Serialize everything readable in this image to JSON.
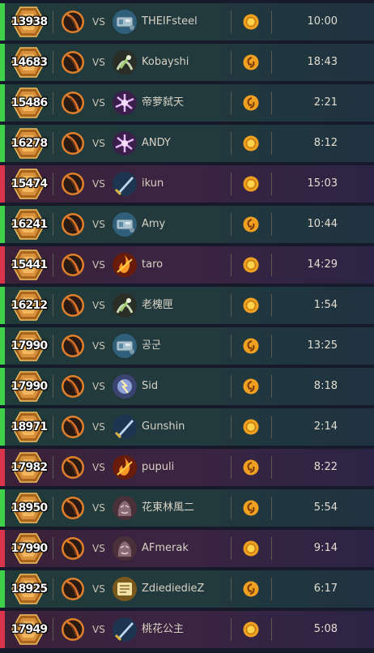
{
  "vs_label": "VS",
  "colors": {
    "win": "#3fd14a",
    "loss": "#d8344c"
  },
  "matches": [
    {
      "rating": "13938",
      "result": "win",
      "opponent_name": "THEIFsteel",
      "opponent_hero": "mech-hero-icon",
      "coin": "coin",
      "duration": "10:00"
    },
    {
      "rating": "14683",
      "result": "win",
      "opponent_name": "Kobayshi",
      "opponent_hero": "nature-hero-icon",
      "coin": "coin-flip",
      "duration": "18:43"
    },
    {
      "rating": "15486",
      "result": "win",
      "opponent_name": "帝萝弑天",
      "opponent_hero": "arcane-hero-icon",
      "coin": "coin-flip",
      "duration": "2:21"
    },
    {
      "rating": "16278",
      "result": "win",
      "opponent_name": "ANDY",
      "opponent_hero": "arcane-hero-icon",
      "coin": "coin",
      "duration": "8:12"
    },
    {
      "rating": "15474",
      "result": "loss",
      "opponent_name": "ikun",
      "opponent_hero": "blade-hero-icon",
      "coin": "coin",
      "duration": "15:03"
    },
    {
      "rating": "16241",
      "result": "win",
      "opponent_name": "Amy",
      "opponent_hero": "mech-hero-icon",
      "coin": "coin-flip",
      "duration": "10:44"
    },
    {
      "rating": "15441",
      "result": "loss",
      "opponent_name": "taro",
      "opponent_hero": "fire-hero-icon",
      "coin": "coin",
      "duration": "14:29"
    },
    {
      "rating": "16212",
      "result": "win",
      "opponent_name": "老槐匣",
      "opponent_hero": "nature-hero-icon",
      "coin": "coin",
      "duration": "1:54"
    },
    {
      "rating": "17990",
      "result": "win",
      "opponent_name": "공군",
      "opponent_hero": "mech-hero-icon",
      "coin": "coin-flip",
      "duration": "13:25"
    },
    {
      "rating": "17990",
      "result": "win",
      "opponent_name": "Sid",
      "opponent_hero": "storm-hero-icon",
      "coin": "coin-flip",
      "duration": "8:18"
    },
    {
      "rating": "18971",
      "result": "win",
      "opponent_name": "Gunshin",
      "opponent_hero": "blade-hero-icon",
      "coin": "coin",
      "duration": "2:14"
    },
    {
      "rating": "17982",
      "result": "loss",
      "opponent_name": "pupuli",
      "opponent_hero": "fire-hero-icon",
      "coin": "coin-flip",
      "duration": "8:22"
    },
    {
      "rating": "18950",
      "result": "win",
      "opponent_name": "花東林風二",
      "opponent_hero": "beast-hero-icon",
      "coin": "coin-flip",
      "duration": "5:54"
    },
    {
      "rating": "17990",
      "result": "loss",
      "opponent_name": "AFmerak",
      "opponent_hero": "beast-hero-icon",
      "coin": "coin",
      "duration": "9:14"
    },
    {
      "rating": "18925",
      "result": "win",
      "opponent_name": "ZdiediedieZ",
      "opponent_hero": "relic-hero-icon",
      "coin": "coin-flip",
      "duration": "6:17"
    },
    {
      "rating": "17949",
      "result": "loss",
      "opponent_name": "桃花公主",
      "opponent_hero": "blade-hero-icon",
      "coin": "coin",
      "duration": "5:08"
    }
  ]
}
